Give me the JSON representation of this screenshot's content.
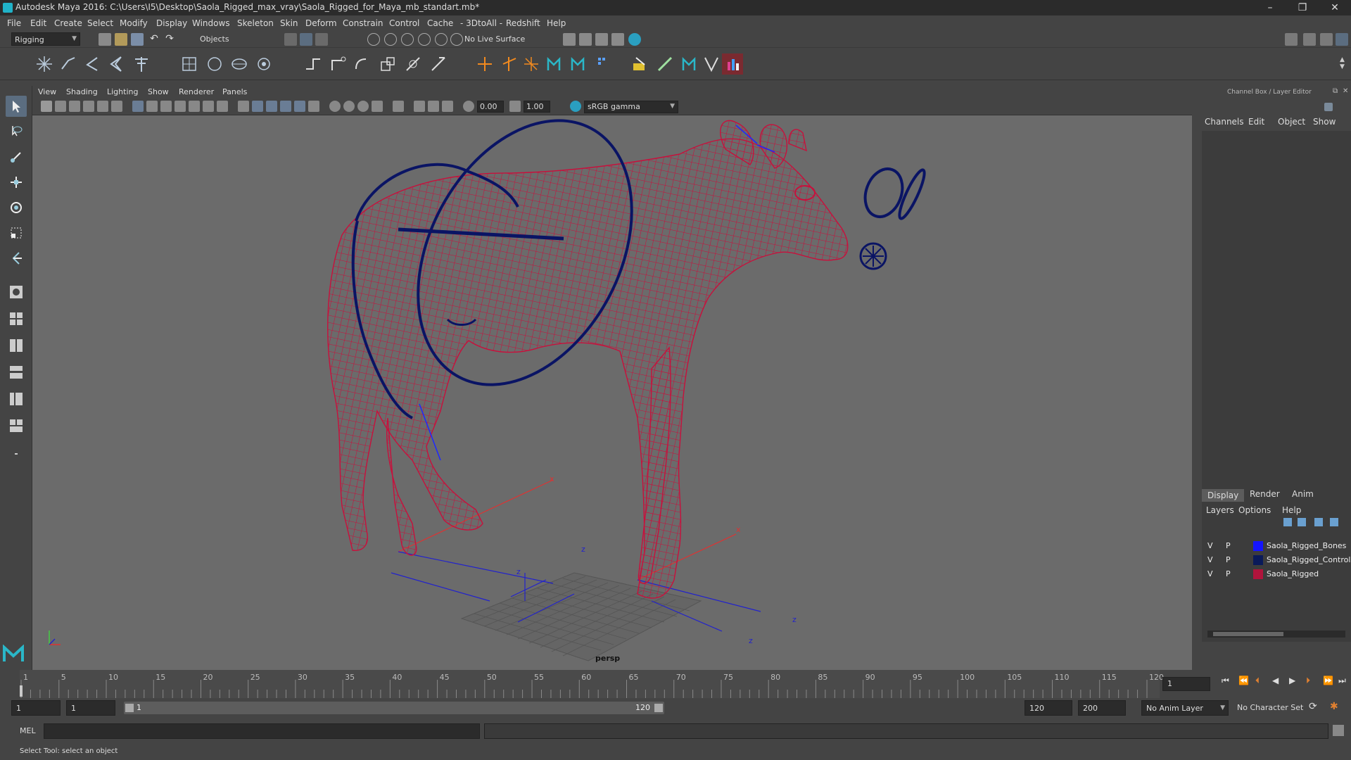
{
  "window": {
    "title": "Autodesk Maya 2016: C:\\Users\\I5\\Desktop\\Saola_Rigged_max_vray\\Saola_Rigged_for_Maya_mb_standart.mb*",
    "minimize": "–",
    "maximize": "❐",
    "close": "✕"
  },
  "menubar": [
    "File",
    "Edit",
    "Create",
    "Select",
    "Modify",
    "Display",
    "Windows",
    "Skeleton",
    "Skin",
    "Deform",
    "Constrain",
    "Control",
    "Cache",
    "- 3DtoAll -",
    "Redshift",
    "Help"
  ],
  "status_line": {
    "menu_set": "Rigging",
    "selection_mode": "Objects",
    "live_surface": "No Live Surface"
  },
  "viewport": {
    "menu": [
      "View",
      "Shading",
      "Lighting",
      "Show",
      "Renderer",
      "Panels"
    ],
    "exposure": "0.00",
    "gamma": "1.00",
    "color_space": "sRGB gamma",
    "camera_label": "persp",
    "axis_z": "z",
    "axis_x": "x"
  },
  "channel_box": {
    "header": "Channel Box / Layer Editor",
    "tabs": [
      "Channels",
      "Edit",
      "Object",
      "Show"
    ],
    "layer_tabs": [
      "Display",
      "Render",
      "Anim"
    ],
    "active_layer_tab": "Display",
    "layer_menu": [
      "Layers",
      "Options",
      "Help"
    ],
    "layers": [
      {
        "v": "V",
        "p": "P",
        "color": "#1414ff",
        "name": "Saola_Rigged_Bones"
      },
      {
        "v": "V",
        "p": "P",
        "color": "#0a1a5a",
        "name": "Saola_Rigged_Controls"
      },
      {
        "v": "V",
        "p": "P",
        "color": "#b0143c",
        "name": "Saola_Rigged"
      }
    ]
  },
  "timeline": {
    "labels": [
      "1",
      "5",
      "10",
      "15",
      "20",
      "25",
      "30",
      "35",
      "40",
      "45",
      "50",
      "55",
      "60",
      "65",
      "70",
      "75",
      "80",
      "85",
      "90",
      "95",
      "100",
      "105",
      "110",
      "115",
      "120"
    ],
    "current_frame": "1"
  },
  "range": {
    "start": "1",
    "playback_start": "1",
    "slider_start": "1",
    "slider_end": "120",
    "playback_end": "120",
    "end": "200",
    "anim_layer": "No Anim Layer",
    "character_set": "No Character Set"
  },
  "command_line": {
    "mode": "MEL"
  },
  "help_line": "Select Tool: select an object",
  "colors": {
    "wireframe": "#c8103c",
    "controls": "#0a1464",
    "bones": "#1e28ff",
    "accent": "#5b6d80"
  }
}
